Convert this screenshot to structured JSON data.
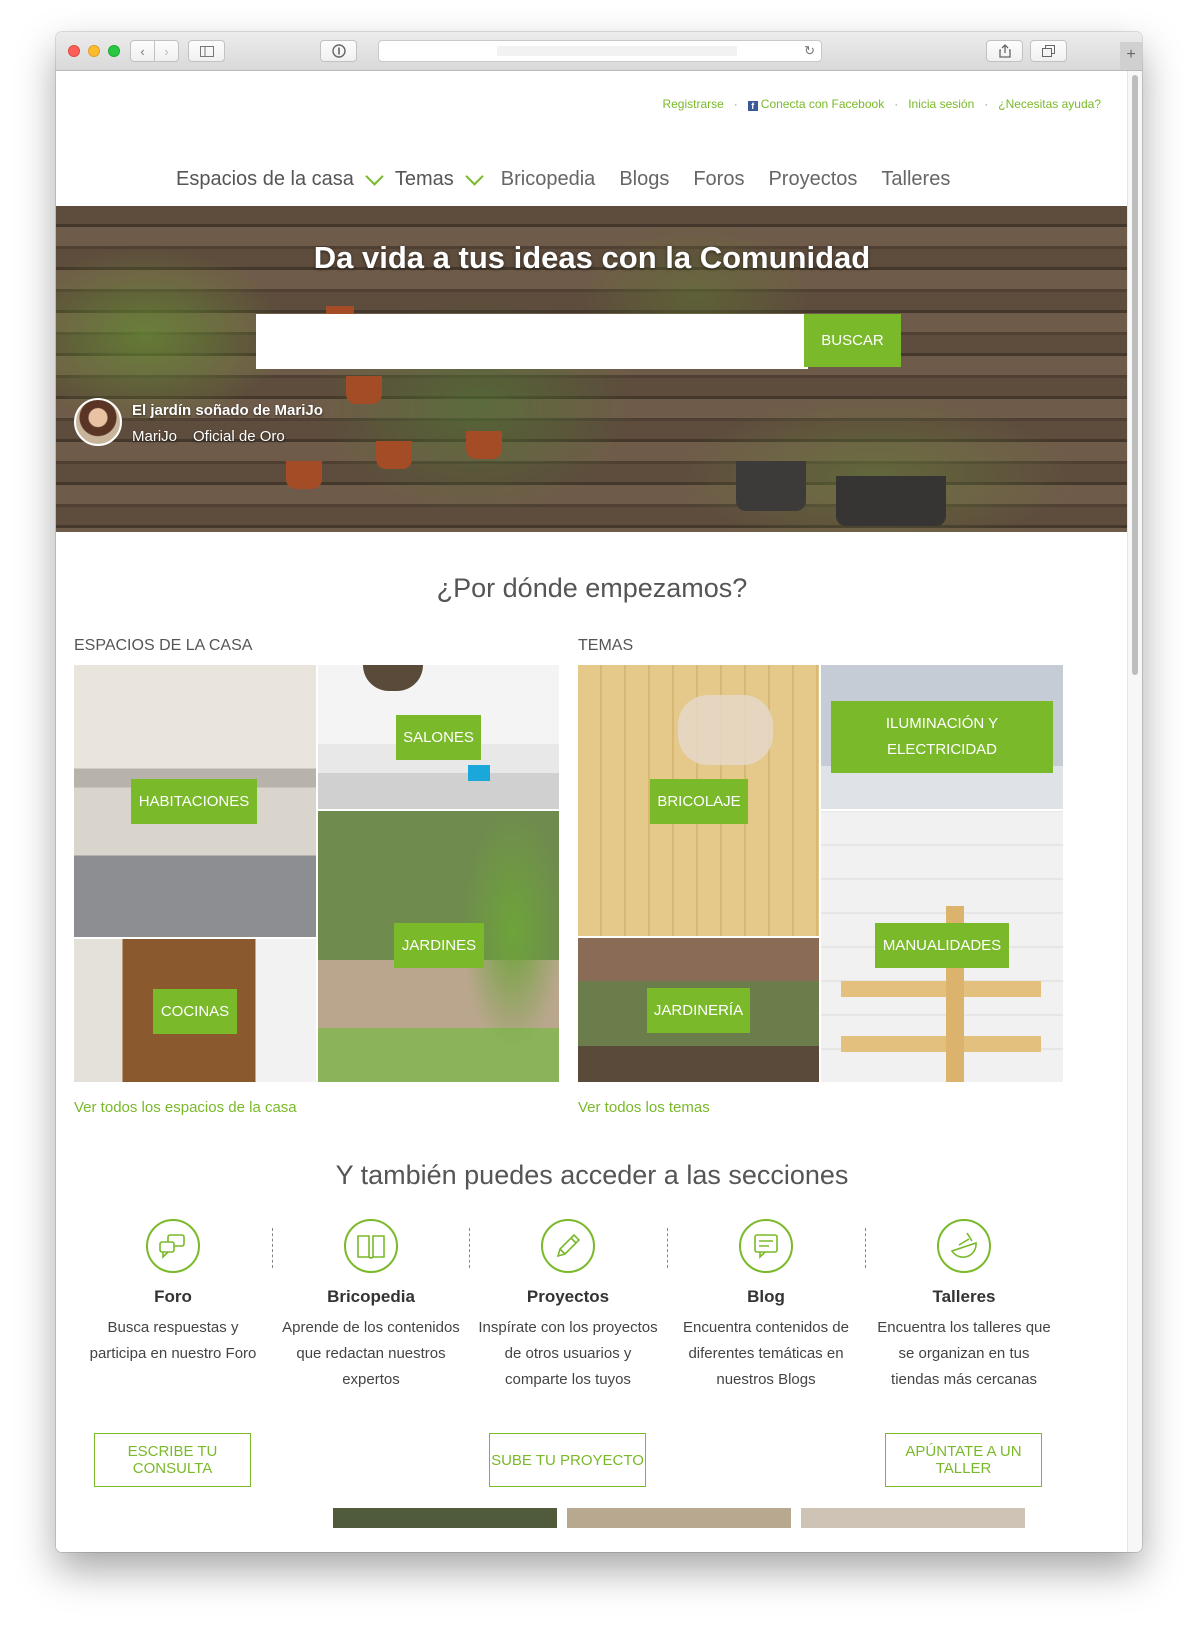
{
  "toplinks": {
    "register": "Registrarse",
    "facebook": "Conecta con Facebook",
    "login": "Inicia sesión",
    "help": "¿Necesitas ayuda?"
  },
  "nav": {
    "items": [
      "Espacios de la casa",
      "Temas",
      "Bricopedia",
      "Blogs",
      "Foros",
      "Proyectos",
      "Talleres"
    ]
  },
  "hero": {
    "title": "Da vida a tus ideas con la Comunidad",
    "search_placeholder": "",
    "search_button": "BUSCAR",
    "credit_title": "El jardín soñado de MariJo",
    "credit_user": "MariJo",
    "credit_rank": "Oficial de Oro"
  },
  "start": {
    "title": "¿Por dónde empezamos?",
    "espacios_heading": "ESPACIOS DE LA CASA",
    "temas_heading": "TEMAS",
    "espacios": [
      "HABITACIONES",
      "SALONES",
      "JARDINES",
      "COCINAS"
    ],
    "temas": [
      "BRICOLAJE",
      "ILUMINACIÓN Y ELECTRICIDAD",
      "MANUALIDADES",
      "JARDINERÍA"
    ],
    "see_espacios": "Ver todos los espacios de la casa",
    "see_temas": "Ver todos los temas"
  },
  "sections": {
    "title": "Y también puedes acceder a las secciones",
    "items": [
      {
        "name": "Foro",
        "desc": "Busca respuestas y participa en nuestro Foro",
        "icon": "chat-bubbles-icon"
      },
      {
        "name": "Bricopedia",
        "desc": "Aprende de los contenidos que redactan nuestros expertos",
        "icon": "book-icon"
      },
      {
        "name": "Proyectos",
        "desc": "Inspírate con los proyectos de otros usuarios y comparte los tuyos",
        "icon": "pencil-icon"
      },
      {
        "name": "Blog",
        "desc": "Encuentra contenidos de diferentes temáticas en nuestros Blogs",
        "icon": "document-chat-icon"
      },
      {
        "name": "Talleres",
        "desc": "Encuentra los talleres que se organizan en tus tiendas más cercanas",
        "icon": "workshop-icon"
      }
    ],
    "buttons": {
      "foro": "ESCRIBE TU CONSULTA",
      "proyectos": "SUBE TU PROYECTO",
      "talleres": "APÚNTATE A UN TALLER"
    }
  },
  "colors": {
    "accent": "#7ab929",
    "text": "#555555"
  }
}
